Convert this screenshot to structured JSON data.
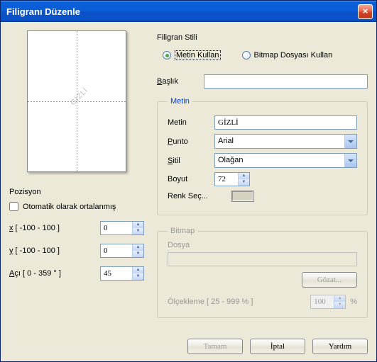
{
  "window": {
    "title": "Filigranı Düzenle"
  },
  "style_section": {
    "label": "Filigran Stili",
    "option_text": "Metin Kullan",
    "option_bitmap": "Bitmap Dosyası Kullan",
    "selected": "text"
  },
  "caption": {
    "label_u": "B",
    "label_rest": "aşlık",
    "value": ""
  },
  "text_group": {
    "legend": "Metin",
    "text": {
      "label": "Metin",
      "value": "GİZLİ"
    },
    "font": {
      "label_u": "P",
      "label_rest": "unto",
      "value": "Arial"
    },
    "style_sel": {
      "label_u": "S",
      "label_rest": "itil",
      "value": "Olağan"
    },
    "size": {
      "label": "Boyut",
      "value": "72"
    },
    "color": {
      "label": "Renk Seç..."
    }
  },
  "bitmap_group": {
    "legend": "Bitmap",
    "file_label": "Dosya",
    "file_value": "",
    "browse": "Gözat...",
    "scale_label": "Ölçekleme [ 25 - 999 % ]",
    "scale_value": "100",
    "scale_unit": "%"
  },
  "position": {
    "label": "Pozisyon",
    "auto_center": "Otomatik olarak ortalanmış",
    "auto_center_checked": false,
    "x": {
      "label_u": "x",
      "label_rest": " [ -100 - 100 ]",
      "value": "0"
    },
    "y": {
      "label_u": "y",
      "label_rest": " [ -100 - 100 ]",
      "value": "0"
    },
    "angle": {
      "label_u": "A",
      "label_rest": "çı [ 0 - 359 ° ]",
      "value": "45"
    }
  },
  "preview": {
    "watermark": "GİZLİ"
  },
  "buttons": {
    "ok": "Tamam",
    "cancel": "İptal",
    "help": "Yardım"
  }
}
